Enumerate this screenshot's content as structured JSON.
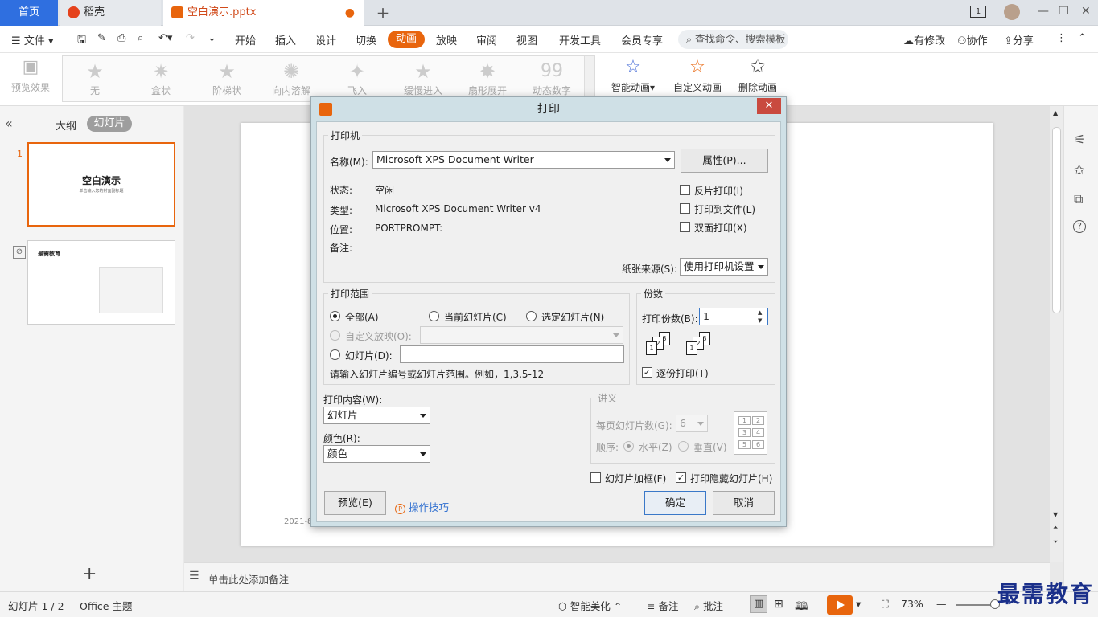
{
  "tabs": {
    "home": "首页",
    "daoke": "稻壳",
    "file": "空白演示.pptx"
  },
  "window": {
    "page_badge": "1"
  },
  "menu": {
    "file": "文件",
    "items": [
      "开始",
      "插入",
      "设计",
      "切换",
      "动画",
      "放映",
      "审阅",
      "视图",
      "开发工具",
      "会员专享"
    ],
    "search": "查找命令、搜索模板",
    "modified": "有修改",
    "collab": "协作",
    "share": "分享"
  },
  "ribbon": {
    "preview": "预览效果",
    "gallery": [
      "无",
      "盒状",
      "阶梯状",
      "向内溶解",
      "飞入",
      "缓慢进入",
      "扇形展开",
      "动态数字"
    ],
    "smart_anim": "智能动画",
    "custom_anim": "自定义动画",
    "delete_anim": "删除动画"
  },
  "sidebar": {
    "outline": "大纲",
    "slides": "幻灯片",
    "slide1": {
      "num": "1",
      "title": "空白演示",
      "subtitle": "单击输入您的封面副标题"
    },
    "slide2": {
      "title": "最需教育"
    }
  },
  "slide": {
    "date": "2021-8-"
  },
  "notes": {
    "placeholder": "单击此处添加备注"
  },
  "status": {
    "slide_count": "幻灯片 1 / 2",
    "theme": "Office 主题",
    "beautify": "智能美化",
    "notes": "备注",
    "comments": "批注",
    "zoom": "73%"
  },
  "watermark": "最需教育",
  "dialog": {
    "title": "打印",
    "close": "✕",
    "printer": {
      "legend": "打印机",
      "name_label": "名称(M):",
      "name_value": "Microsoft XPS Document Writer",
      "properties": "属性(P)...",
      "status_label": "状态:",
      "status_value": "空闲",
      "type_label": "类型:",
      "type_value": "Microsoft XPS Document Writer v4",
      "where_label": "位置:",
      "where_value": "PORTPROMPT:",
      "comment_label": "备注:",
      "reverse": "反片打印(I)",
      "to_file": "打印到文件(L)",
      "duplex": "双面打印(X)",
      "paper_label": "纸张来源(S):",
      "paper_value": "使用打印机设置"
    },
    "range": {
      "legend": "打印范围",
      "all": "全部(A)",
      "current": "当前幻灯片(C)",
      "selected": "选定幻灯片(N)",
      "custom": "自定义放映(O):",
      "slides": "幻灯片(D):",
      "hint": "请输入幻灯片编号或幻灯片范围。例如，1,3,5-12"
    },
    "copies": {
      "legend": "份数",
      "label": "打印份数(B):",
      "value": "1",
      "collate": "逐份打印(T)"
    },
    "content": {
      "label": "打印内容(W):",
      "value": "幻灯片"
    },
    "color": {
      "label": "颜色(R):",
      "value": "颜色"
    },
    "handout": {
      "legend": "讲义",
      "per_page_label": "每页幻灯片数(G):",
      "per_page_value": "6",
      "order_label": "顺序:",
      "horizontal": "水平(Z)",
      "vertical": "垂直(V)"
    },
    "frame": "幻灯片加框(F)",
    "hidden": "打印隐藏幻灯片(H)",
    "preview": "预览(E)",
    "tips": "操作技巧",
    "ok": "确定",
    "cancel": "取消"
  }
}
